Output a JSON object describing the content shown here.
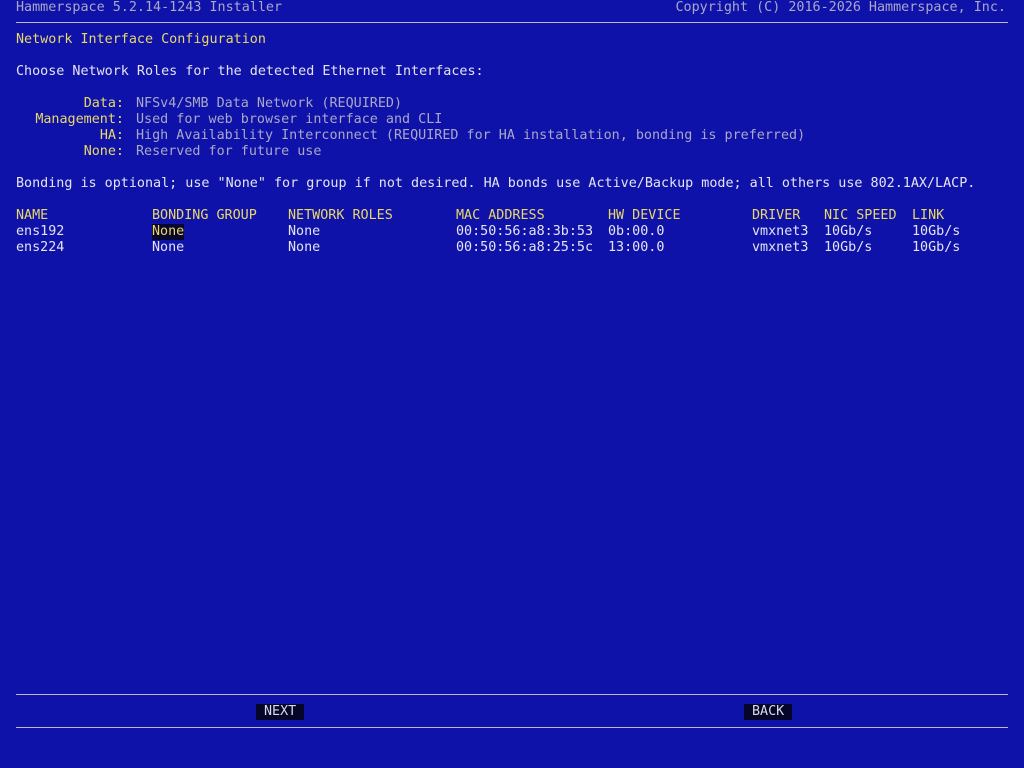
{
  "header": {
    "title": "Hammerspace 5.2.14-1243 Installer",
    "copyright": "Copyright (C) 2016-2026 Hammerspace, Inc."
  },
  "page_title": "Network Interface Configuration",
  "intro": "Choose Network Roles for the detected Ethernet Interfaces:",
  "roles": [
    {
      "label": "Data:",
      "desc": "NFSv4/SMB Data Network (REQUIRED)"
    },
    {
      "label": "Management:",
      "desc": "Used for web browser interface and CLI"
    },
    {
      "label": "HA:",
      "desc": "High Availability Interconnect (REQUIRED for HA installation, bonding is preferred)"
    },
    {
      "label": "None:",
      "desc": "Reserved for future use"
    }
  ],
  "bonding_note": "Bonding is optional; use \"None\" for group if not desired. HA bonds use Active/Backup mode; all others use 802.1AX/LACP.",
  "table": {
    "headers": {
      "name": "NAME",
      "bonding_group": "BONDING GROUP",
      "network_roles": "NETWORK ROLES",
      "mac_address": "MAC ADDRESS",
      "hw_device": "HW DEVICE",
      "driver": "DRIVER",
      "nic_speed": "NIC SPEED",
      "link": "LINK"
    },
    "rows": [
      {
        "name": "ens192",
        "bonding_group": "None",
        "network_roles": "None",
        "mac_address": "00:50:56:a8:3b:53",
        "hw_device": "0b:00.0",
        "driver": "vmxnet3",
        "nic_speed": "10Gb/s",
        "link": "10Gb/s"
      },
      {
        "name": "ens224",
        "bonding_group": "None",
        "network_roles": "None",
        "mac_address": "00:50:56:a8:25:5c",
        "hw_device": "13:00.0",
        "driver": "vmxnet3",
        "nic_speed": "10Gb/s",
        "link": "10Gb/s"
      }
    ]
  },
  "buttons": {
    "next": "NEXT",
    "back": "BACK"
  },
  "colors": {
    "background": "#0f12a8",
    "highlight": "#e8d86a"
  }
}
